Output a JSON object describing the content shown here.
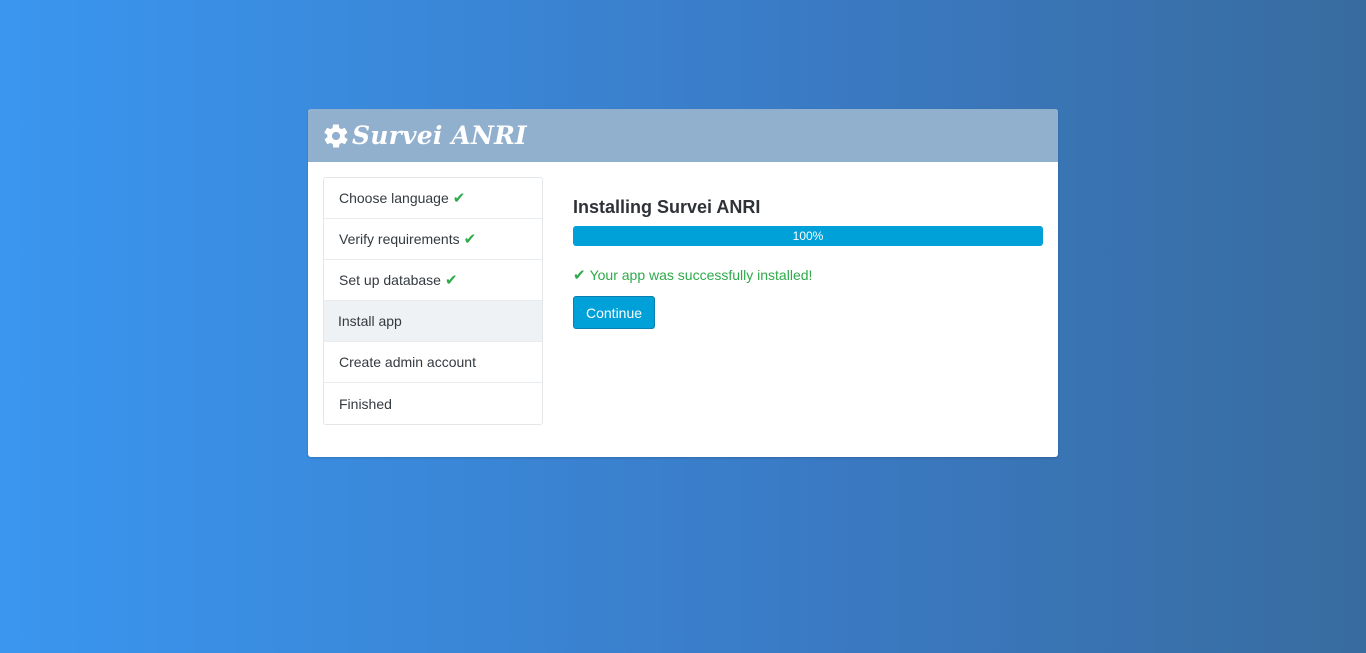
{
  "header": {
    "icon": "gear-icon",
    "brand": "Survei ANRI"
  },
  "steps": [
    {
      "label": "Choose language",
      "done": true
    },
    {
      "label": "Verify requirements",
      "done": true
    },
    {
      "label": "Set up database",
      "done": true
    },
    {
      "label": "Install app",
      "done": false,
      "active": true
    },
    {
      "label": "Create admin account",
      "done": false
    },
    {
      "label": "Finished",
      "done": false
    }
  ],
  "main": {
    "title": "Installing Survei ANRI",
    "progress": {
      "value": 100,
      "label": "100%"
    },
    "success_message": "Your app was successfully installed!",
    "continue_label": "Continue"
  },
  "colors": {
    "header_bg": "#91b0ce",
    "accent": "#00a1d9",
    "success": "#2eaa4a"
  }
}
